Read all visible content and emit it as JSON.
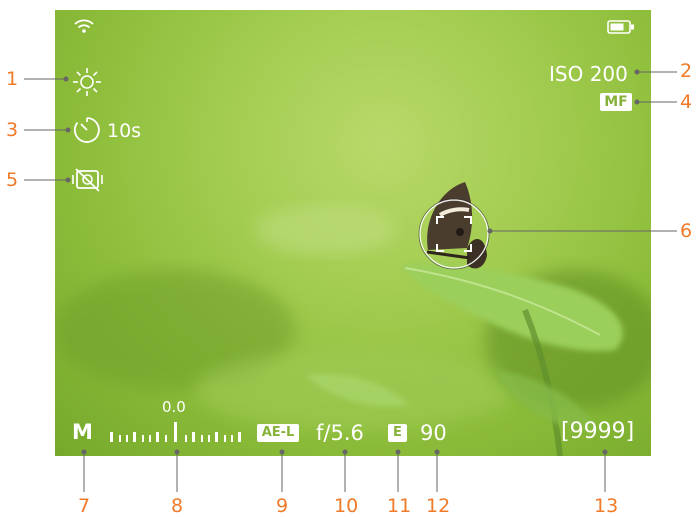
{
  "viewfinder": {
    "iso": "ISO 200",
    "focus_mode": "MF",
    "self_timer": "10s",
    "mode": "M",
    "exposure_value": "0.0",
    "ae_lock": "AE-L",
    "aperture": "f/5.6",
    "e_badge": "E",
    "shutter": "90",
    "shots_remaining": "[9999]"
  },
  "icons": {
    "wifi": "wifi-icon",
    "battery": "battery-icon",
    "white_balance": "sun-icon",
    "timer": "self-timer-icon",
    "stabilizer": "stabilizer-off-icon",
    "focus": "focus-frame-icon"
  },
  "callouts": [
    "1",
    "2",
    "3",
    "4",
    "5",
    "6",
    "7",
    "8",
    "9",
    "10",
    "11",
    "12",
    "13"
  ],
  "colors": {
    "callout": "#f07a28",
    "overlay": "#ffffff"
  }
}
